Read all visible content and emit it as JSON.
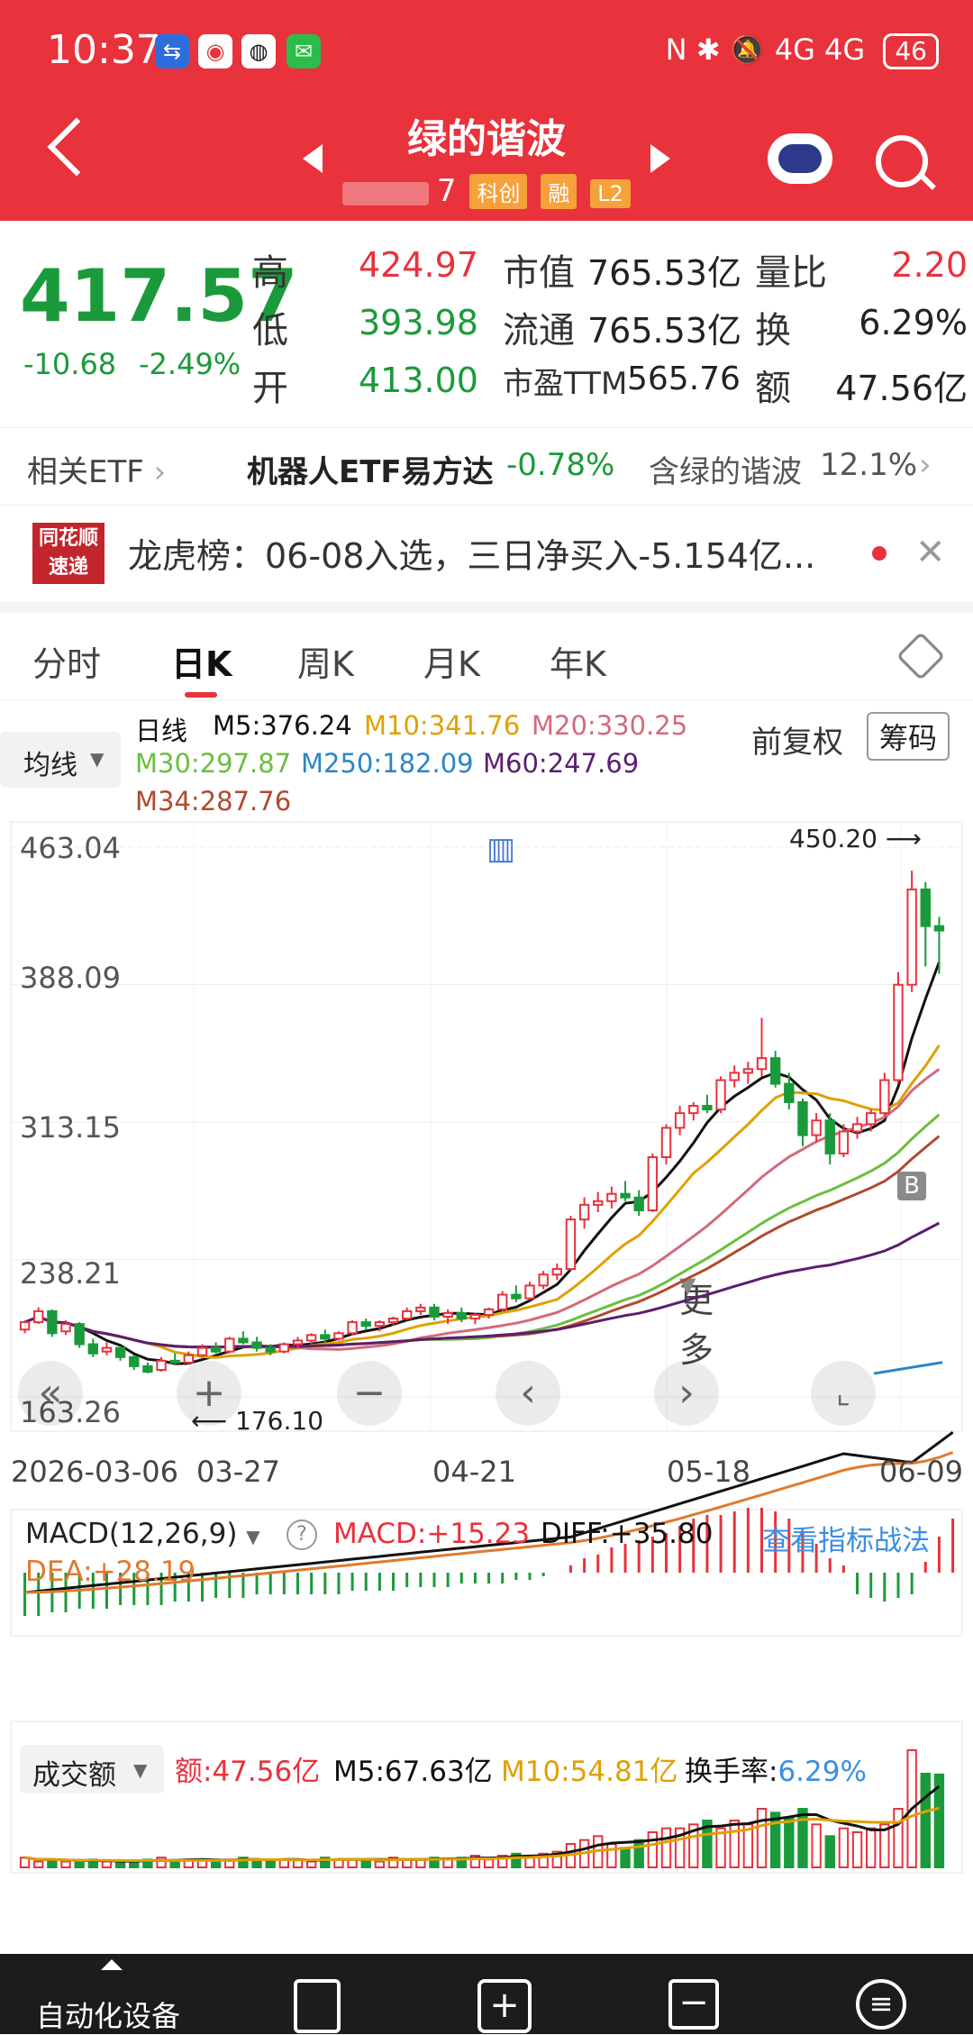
{
  "status_bar": {
    "time": "10:37",
    "right": "N ✱ 🔕 4G 4G",
    "battery": "46"
  },
  "header": {
    "title": "绿的谐波",
    "code": "7",
    "tags": [
      "科创",
      "融",
      "L2"
    ]
  },
  "quote": {
    "price": "417.57",
    "change": "-10.68",
    "change_pct": "-2.49%",
    "labels": {
      "high": "高",
      "low": "低",
      "open": "开",
      "mktcap": "市值",
      "float": "流通",
      "pe": "市盈TTM",
      "vol_ratio": "量比",
      "turnover": "换",
      "amount": "额"
    },
    "high": "424.97",
    "low": "393.98",
    "open": "413.00",
    "mktcap": "765.53亿",
    "float": "765.53亿",
    "pe": "565.76",
    "vol_ratio": "2.20",
    "turnover": "6.29%",
    "amount": "47.56亿"
  },
  "etf": {
    "label": "相关ETF",
    "name": "机器人ETF易方达",
    "pct": "-0.78%",
    "holding": "含绿的谐波",
    "holding_pct": "12.1%"
  },
  "news": {
    "logo": "同花顺速递",
    "text": "龙虎榜：06-08入选，三日净买入-5.154亿..."
  },
  "tabs": [
    "分时",
    "日K",
    "周K",
    "月K",
    "年K",
    "更多"
  ],
  "ma": {
    "selector": "均线",
    "period": "日线",
    "m5": "M5:376.24",
    "m10": "M10:341.76",
    "m20": "M20:330.25",
    "m30": "M30:297.87",
    "m250": "M250:182.09",
    "m60": "M60:247.69",
    "m34": "M34:287.76",
    "adjust": "前复权",
    "chips": "筹码"
  },
  "price_axis": [
    "463.04",
    "388.09",
    "313.15",
    "238.21",
    "163.26"
  ],
  "annotations": {
    "high": "450.20",
    "low": "176.10",
    "b": "B"
  },
  "dates": [
    "2026-03-06",
    "03-27",
    "04-21",
    "05-18",
    "06-09"
  ],
  "macd": {
    "selector": "MACD(12,26,9)",
    "macd": "MACD:+15.23",
    "diff": "DIFF:+35.80",
    "dea": "DEA:+28.19",
    "link": "查看指标战法"
  },
  "volume": {
    "selector": "成交额",
    "amount": "额:47.56亿",
    "m5": "M5:67.63亿",
    "m10": "M10:54.81亿",
    "turnover_label": "换手率:",
    "turnover": "6.29%"
  },
  "bottom": {
    "label": "自动化设备"
  },
  "colors": {
    "header": "#e8323c",
    "up": "#e8323c",
    "down": "#1a9a3a",
    "m5": "#111111",
    "m10": "#e0a000",
    "m20": "#d36a7a",
    "m30": "#6abf40",
    "m250": "#2a86c6",
    "m60": "#5b1f6e",
    "m34": "#b04a30"
  },
  "chart_data": {
    "type": "candlestick",
    "y_range": [
      163.26,
      463.04
    ],
    "candles": [
      [
        200,
        205,
        198,
        204
      ],
      [
        204,
        212,
        203,
        210
      ],
      [
        210,
        211,
        196,
        198
      ],
      [
        199,
        205,
        197,
        203
      ],
      [
        203,
        204,
        190,
        192
      ],
      [
        192,
        195,
        185,
        187
      ],
      [
        188,
        193,
        186,
        190
      ],
      [
        190,
        191,
        183,
        185
      ],
      [
        185,
        186,
        178,
        180
      ],
      [
        180,
        182,
        176.1,
        177
      ],
      [
        178,
        185,
        177,
        183
      ],
      [
        183,
        187,
        181,
        182
      ],
      [
        182,
        188,
        181,
        186
      ],
      [
        186,
        192,
        185,
        190
      ],
      [
        190,
        193,
        187,
        188
      ],
      [
        188,
        196,
        187,
        195
      ],
      [
        195,
        199,
        192,
        193
      ],
      [
        193,
        196,
        188,
        190
      ],
      [
        190,
        192,
        186,
        188
      ],
      [
        188,
        193,
        187,
        192
      ],
      [
        192,
        196,
        190,
        194
      ],
      [
        194,
        198,
        192,
        197
      ],
      [
        197,
        200,
        193,
        195
      ],
      [
        195,
        199,
        194,
        198
      ],
      [
        198,
        205,
        197,
        204
      ],
      [
        204,
        206,
        200,
        202
      ],
      [
        202,
        205,
        199,
        204
      ],
      [
        204,
        207,
        202,
        206
      ],
      [
        206,
        212,
        205,
        210
      ],
      [
        210,
        214,
        208,
        212
      ],
      [
        212,
        214,
        205,
        207
      ],
      [
        207,
        211,
        203,
        209
      ],
      [
        209,
        212,
        204,
        206
      ],
      [
        206,
        209,
        203,
        208
      ],
      [
        208,
        212,
        206,
        211
      ],
      [
        211,
        221,
        210,
        219
      ],
      [
        219,
        224,
        215,
        217
      ],
      [
        217,
        226,
        216,
        224
      ],
      [
        224,
        232,
        222,
        230
      ],
      [
        230,
        236,
        227,
        233
      ],
      [
        233,
        262,
        232,
        260
      ],
      [
        260,
        272,
        255,
        268
      ],
      [
        268,
        275,
        264,
        270
      ],
      [
        270,
        278,
        266,
        274
      ],
      [
        274,
        281,
        270,
        272
      ],
      [
        272,
        276,
        262,
        265
      ],
      [
        265,
        296,
        264,
        294
      ],
      [
        294,
        312,
        290,
        310
      ],
      [
        310,
        322,
        306,
        318
      ],
      [
        318,
        324,
        314,
        322
      ],
      [
        322,
        328,
        318,
        320
      ],
      [
        320,
        338,
        318,
        336
      ],
      [
        336,
        344,
        332,
        340
      ],
      [
        340,
        346,
        334,
        342
      ],
      [
        342,
        370,
        338,
        348
      ],
      [
        348,
        352,
        332,
        334
      ],
      [
        334,
        340,
        320,
        324
      ],
      [
        324,
        326,
        300,
        306
      ],
      [
        306,
        318,
        302,
        314
      ],
      [
        314,
        318,
        290,
        296
      ],
      [
        296,
        312,
        294,
        308
      ],
      [
        308,
        316,
        304,
        312
      ],
      [
        312,
        320,
        308,
        318
      ],
      [
        318,
        340,
        316,
        336
      ],
      [
        336,
        395,
        334,
        388
      ],
      [
        388,
        450.2,
        384,
        440
      ],
      [
        440,
        444,
        398,
        420
      ],
      [
        420,
        424.97,
        393.98,
        417.57
      ]
    ],
    "macd_bars": [
      -12,
      -12,
      -11,
      -11,
      -10,
      -10,
      -10,
      -9,
      -9,
      -9,
      -9,
      -8,
      -8,
      -8,
      -7,
      -7,
      -7,
      -6,
      -6,
      -6,
      -6,
      -6,
      -6,
      -6,
      -5,
      -5,
      -5,
      -5,
      -4,
      -4,
      -4,
      -4,
      -3,
      -3,
      -3,
      -3,
      -2,
      -2,
      -1,
      0,
      2,
      4,
      5,
      7,
      8,
      9,
      10,
      11,
      13,
      15,
      16,
      16,
      17,
      18,
      18,
      17,
      15,
      11,
      8,
      4,
      2,
      -6,
      -7,
      -8,
      -7,
      -6,
      3,
      10,
      15
    ],
    "volume_bars": [
      5,
      3,
      4,
      3,
      3,
      4,
      3,
      3,
      3,
      4,
      5,
      3,
      4,
      4,
      3,
      4,
      5,
      4,
      3,
      4,
      4,
      3,
      5,
      4,
      4,
      4,
      3,
      5,
      4,
      4,
      5,
      4,
      5,
      6,
      4,
      6,
      7,
      6,
      7,
      8,
      12,
      14,
      16,
      12,
      10,
      14,
      18,
      20,
      20,
      22,
      24,
      20,
      24,
      22,
      30,
      28,
      25,
      30,
      22,
      16,
      20,
      18,
      20,
      22,
      30,
      60,
      48,
      47.56
    ]
  }
}
